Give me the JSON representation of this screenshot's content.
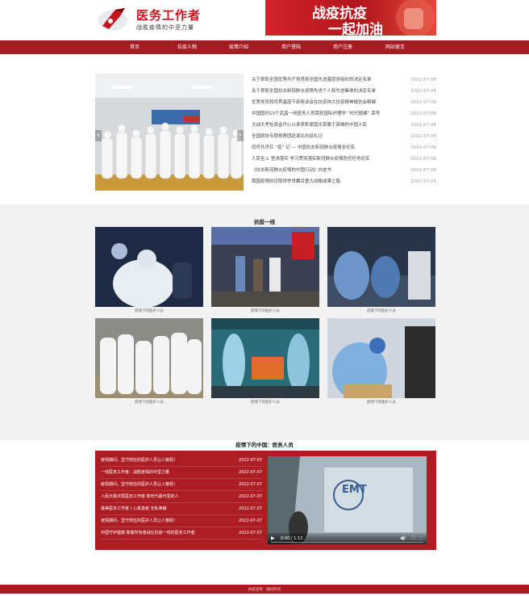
{
  "header": {
    "logo_title": "医务工作者",
    "logo_subtitle": "战胜疫情的中坚力量",
    "banner_line1": "战疫抗疫",
    "banner_line2": "一起加油"
  },
  "nav": {
    "items": [
      "首页",
      "抗疫人物",
      "疫情介绍",
      "用户登陆",
      "用户注册",
      "网站留言"
    ]
  },
  "news": {
    "items": [
      {
        "title": "关于表彰全国优秀共产党员和全国先进基层党组织的决定名单",
        "date": "2022-07-06"
      },
      {
        "title": "关于表彰全国抗击新冠肺炎疫情先进个人和先进集体的决定名单",
        "date": "2022-07-06"
      },
      {
        "title": "优秀党员和优秀基层干部座谈会在抗疫伟大抗疫精神报告会精编",
        "date": "2022-07-06"
      },
      {
        "title": "中国国内10个武昌一线医务人员荣获国际护理学 “时代楷模” 荣号",
        "date": "2022-07-06"
      },
      {
        "title": "大战大考检真金丹心以承表彰家国光荣属于英雄的中国人民",
        "date": "2022-07-06"
      },
      {
        "title": "全国政协专题视察团赴湖北抗疫札记",
        "date": "2022-07-06"
      },
      {
        "title": "同舟共济扛 “疫” 记 — 中国抗击新冠肺炎疫情全纪实",
        "date": "2022-07-06"
      },
      {
        "title": "人民至上 坚决落实 学习贯彻落实新冠肺炎疫情防控任务纪实",
        "date": "2022-07-06"
      },
      {
        "title": "《抗击新冠肺炎疫情的中国行动》白皮书",
        "date": "2022-07-06"
      },
      {
        "title": "我国疫情防控取得举世瞩目重大战略成果之路",
        "date": "2022-07-06"
      }
    ]
  },
  "gallery": {
    "title": "抗疫一线",
    "caption": "疫情下的医护人员",
    "count_label": [
      "疫情下的医护人员",
      "疫情下的医护人员",
      "疫情下的医护人员",
      "疫情下的医护人员",
      "疫情下的医护人员",
      "疫情下的医护人员"
    ]
  },
  "china": {
    "title": "疫情下的中国：医务人员",
    "items": [
      {
        "title": "疫情期间，坚守岗位的医护人员让人敬佩！",
        "date": "2022-07-07"
      },
      {
        "title": "一线医务工作者：战胜疫情的中坚力量",
        "date": "2022-07-07"
      },
      {
        "title": "疫情期间，坚守岗位的医护人员让人敬佩！",
        "date": "2022-07-07"
      },
      {
        "title": "人民日报点赞医务工作者 新时代最可爱的人",
        "date": "2022-07-07"
      },
      {
        "title": "最美医务工作者丨心系患者 无私奉献",
        "date": "2022-07-07"
      },
      {
        "title": "疫情期间，坚守岗位的医护人员让人敬佩！",
        "date": "2022-07-07"
      },
      {
        "title": "中国守护健康 致敬所有奋战在抗疫一线的医务工作者",
        "date": "2022-07-07"
      }
    ],
    "video_time": "0:00 / 1:13",
    "video_logo": "EMT"
  },
  "footer": {
    "text": "抗疫宣传 · 版权所有"
  },
  "colors": {
    "brand_red": "#a61b22",
    "box_red": "#ad1d24"
  }
}
